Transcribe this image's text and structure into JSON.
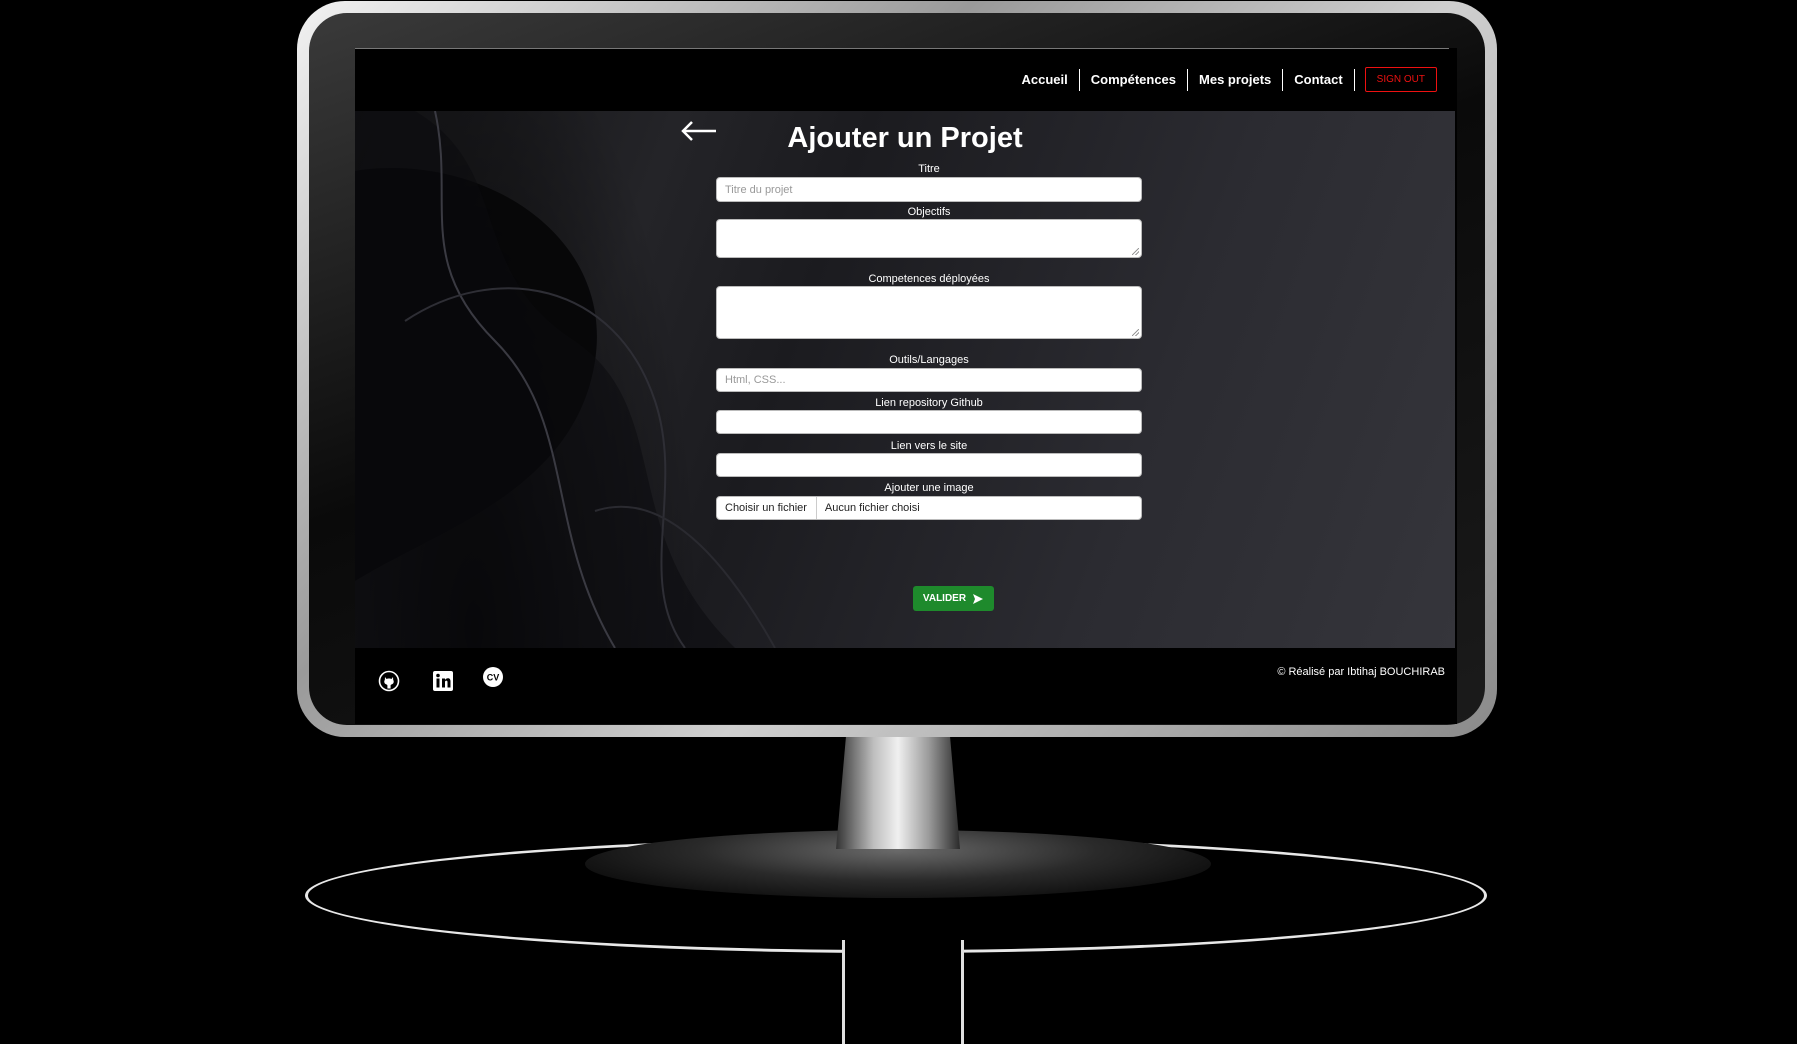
{
  "nav": {
    "items": [
      "Accueil",
      "Compétences",
      "Mes projets",
      "Contact"
    ],
    "signout_label": "SIGN OUT"
  },
  "form": {
    "title": "Ajouter un Projet",
    "back_icon": "arrow-left-icon",
    "fields": {
      "titre": {
        "label": "Titre",
        "placeholder": "Titre du projet"
      },
      "objectifs": {
        "label": "Objectifs",
        "placeholder": ""
      },
      "competences": {
        "label": "Competences déployées",
        "placeholder": ""
      },
      "outils": {
        "label": "Outils/Langages",
        "placeholder": "Html, CSS..."
      },
      "github": {
        "label": "Lien repository Github",
        "placeholder": ""
      },
      "site": {
        "label": "Lien vers le site",
        "placeholder": ""
      },
      "image": {
        "label": "Ajouter une image",
        "button_label": "Choisir un fichier",
        "status": "Aucun fichier choisi"
      }
    },
    "submit_label": "VALIDER",
    "submit_icon": "send-icon"
  },
  "footer": {
    "social": [
      "github-icon",
      "linkedin-icon",
      "cv-icon"
    ],
    "cv_text": "CV",
    "copyright": "© Réalisé par Ibtihaj BOUCHIRAB"
  },
  "colors": {
    "accent_green": "#1e8a2c",
    "signout_red": "#e11111",
    "background": "#000000"
  }
}
